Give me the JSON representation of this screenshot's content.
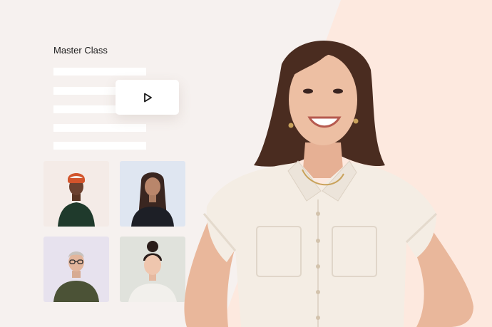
{
  "page": {
    "title": "Master Class"
  },
  "colors": {
    "background": "#f6f1ef",
    "accent_peach": "#fde9df",
    "bars": "#ffffff"
  },
  "video": {
    "play_icon": "play-icon"
  },
  "participants": [
    {
      "name": "participant-man-orange-beanie",
      "bg": "#f4ebe7"
    },
    {
      "name": "participant-woman-long-hair",
      "bg": "#dfe6f1"
    },
    {
      "name": "participant-older-man-glasses",
      "bg": "#e7e2ee"
    },
    {
      "name": "participant-woman-bun",
      "bg": "#e0e2dc"
    }
  ],
  "presenter": {
    "name": "smiling-presenter-woman"
  }
}
